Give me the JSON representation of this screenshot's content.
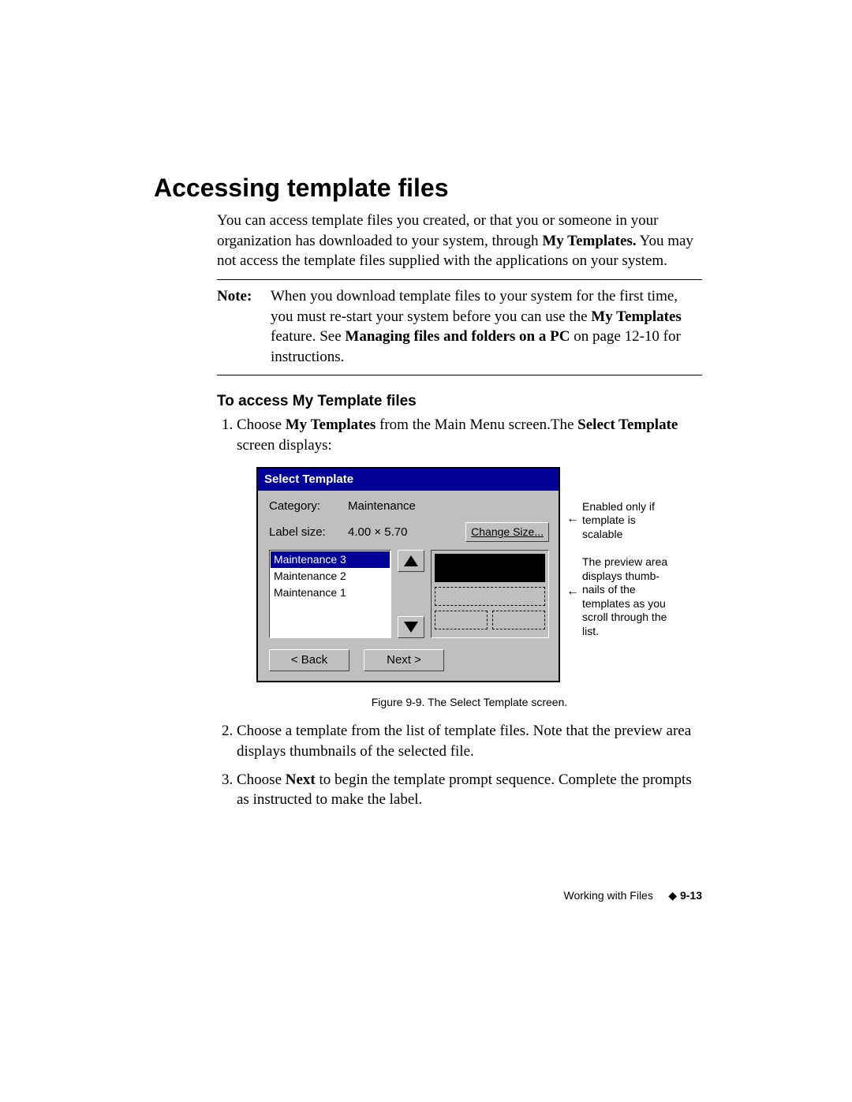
{
  "heading": "Accessing template files",
  "intro_parts": {
    "a": "You can access template files you created, or that you or someone in your organization has downloaded to your system, through ",
    "b": "My Templates.",
    "c": " You may not access the template files supplied with the applications on your system."
  },
  "note": {
    "label": "Note:",
    "a": "When you download template files to your system for the first time, you must re-start your system before you can use the ",
    "b": "My Templates",
    "c": " feature. See ",
    "d": "Managing files and folders on a PC",
    "e": " on page 12-10 for instructions."
  },
  "sub_heading": "To access My Template files",
  "step1": {
    "a": "Choose ",
    "b": "My Templates",
    "c": " from the Main Menu screen.The ",
    "d": "Select Template",
    "e": " screen displays:"
  },
  "dialog": {
    "title": "Select Template",
    "category_label": "Category:",
    "category_value": "Maintenance",
    "labelsize_label": "Label size:",
    "labelsize_value": "4.00 × 5.70",
    "change_size_btn": "Change Size...",
    "items": [
      "Maintenance 3",
      "Maintenance 2",
      "Maintenance 1"
    ],
    "back_btn": "< Back",
    "next_btn": "Next >"
  },
  "annotation1": "Enabled only if template is scalable",
  "annotation2": "The preview area displays thumb-nails of the templates as you scroll through the list.",
  "caption": "Figure 9-9. The Select Template screen.",
  "step2": "Choose a template from the list of template files. Note that the preview area displays thumbnails of the selected file.",
  "step3": {
    "a": "Choose ",
    "b": "Next",
    "c": " to begin the template prompt sequence. Complete the prompts as instructed to make the label."
  },
  "footer": {
    "section": "Working with Files",
    "diamond": "◆",
    "page": "9-13"
  }
}
